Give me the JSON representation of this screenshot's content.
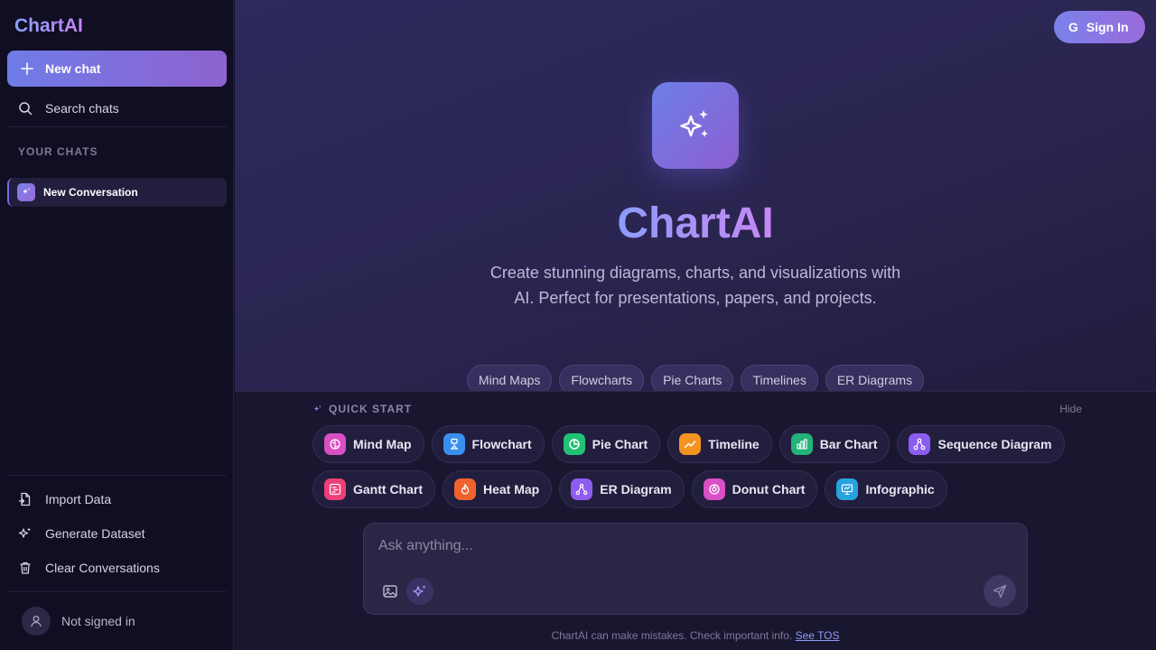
{
  "sidebar": {
    "brand": "ChartAI",
    "new_chat": "New chat",
    "search_chats": "Search chats",
    "section_label": "YOUR CHATS",
    "chats": [
      {
        "label": "New Conversation"
      }
    ],
    "actions": [
      {
        "label": "Import Data",
        "icon": "file-import-icon"
      },
      {
        "label": "Generate Dataset",
        "icon": "sparkles-icon"
      },
      {
        "label": "Clear Conversations",
        "icon": "trash-icon"
      }
    ],
    "user_status": "Not signed in"
  },
  "header": {
    "sign_in_prefix": "G",
    "sign_in_label": "Sign In"
  },
  "hero": {
    "title": "ChartAI",
    "subtitle": "Create stunning diagrams, charts, and visualizations with AI. Perfect for presentations, papers, and projects.",
    "tags": [
      "Mind Maps",
      "Flowcharts",
      "Pie Charts",
      "Timelines",
      "ER Diagrams"
    ]
  },
  "quick_start": {
    "label": "QUICK START",
    "hide": "Hide",
    "row1": [
      {
        "label": "Mind Map",
        "color": "#d94fc4",
        "icon": "brain-icon"
      },
      {
        "label": "Flowchart",
        "color": "#3b8ff0",
        "icon": "flow-icon"
      },
      {
        "label": "Pie Chart",
        "color": "#22c276",
        "icon": "pie-chart-icon"
      },
      {
        "label": "Timeline",
        "color": "#f59320",
        "icon": "trend-icon"
      },
      {
        "label": "Bar Chart",
        "color": "#22b27a",
        "icon": "bar-chart-icon"
      },
      {
        "label": "Sequence Diagram",
        "color": "#8b5cf0",
        "icon": "network-icon"
      }
    ],
    "row2": [
      {
        "label": "Gantt Chart",
        "color": "#ef3f78",
        "icon": "gantt-icon"
      },
      {
        "label": "Heat Map",
        "color": "#f0632f",
        "icon": "flame-icon"
      },
      {
        "label": "ER Diagram",
        "color": "#8f5cf0",
        "icon": "er-icon"
      },
      {
        "label": "Donut Chart",
        "color": "#d94fc4",
        "icon": "donut-icon"
      },
      {
        "label": "Infographic",
        "color": "#27a3e0",
        "icon": "presentation-icon"
      }
    ]
  },
  "composer": {
    "placeholder": "Ask anything..."
  },
  "footer": {
    "disclaimer": "ChartAI can make mistakes. Check important info.",
    "tos_link": "See TOS"
  }
}
